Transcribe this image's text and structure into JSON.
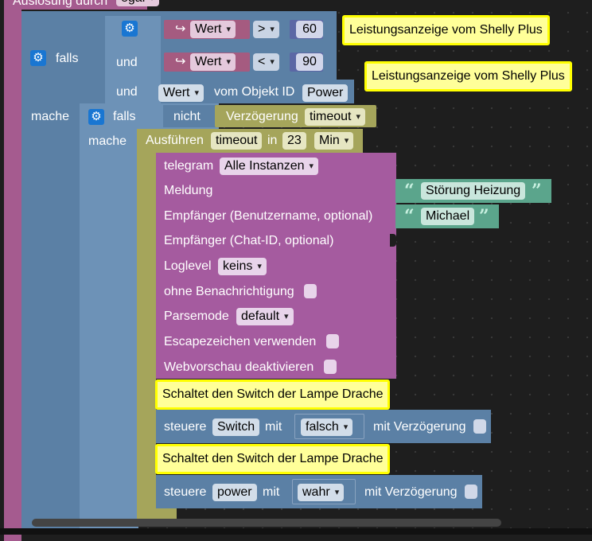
{
  "colors": {
    "purple": "#a55b8f",
    "logic_blue": "#5b80a5",
    "olive": "#a5a55b",
    "telegram_purple": "#a55b9f",
    "text_teal": "#5ba58c",
    "comment_bg": "#ffff99",
    "comment_border": "#ffff00"
  },
  "trigger": {
    "label": "Auslösung durch",
    "value": "egal"
  },
  "if_block": {
    "falls_label": "falls",
    "mache_label": "mache",
    "cond1": {
      "var": "Wert",
      "op": ">",
      "num": "60"
    },
    "und1_label": "und",
    "cond2": {
      "var": "Wert",
      "op": "<",
      "num": "90"
    },
    "und2_label": "und",
    "cond3": {
      "var": "Wert",
      "mid_label": "vom Objekt ID",
      "obj": "Power"
    }
  },
  "comments": {
    "c1": "Leistungsanzeige vom Shelly Plus",
    "c2": "Leistungsanzeige vom Shelly Plus",
    "c3": "Schaltet den Switch der Lampe Drache",
    "c4": "Schaltet den Switch der Lampe Drache"
  },
  "inner_if": {
    "falls_label": "falls",
    "not_label": "nicht",
    "delay_label": "Verzögerung",
    "delay_value": "timeout",
    "mache_label": "mache"
  },
  "execute": {
    "label": "Ausführen",
    "var": "timeout",
    "in_label": "in",
    "num": "23",
    "unit": "Min"
  },
  "telegram": {
    "label": "telegram",
    "instance": "Alle Instanzen",
    "meldung_label": "Meldung",
    "meldung_value": "Störung Heizung",
    "user_label": "Empfänger (Benutzername, optional)",
    "user_value": "Michael",
    "chat_label": "Empfänger (Chat-ID, optional)",
    "loglevel_label": "Loglevel",
    "loglevel_value": "keins",
    "silent_label": "ohne Benachrichtigung",
    "parse_label": "Parsemode",
    "parse_value": "default",
    "escape_label": "Escapezeichen verwenden",
    "preview_label": "Webvorschau deaktivieren"
  },
  "control1": {
    "label": "steuere",
    "target": "Switch",
    "mit_label": "mit",
    "value": "falsch",
    "delay_label": "mit Verzögerung"
  },
  "control2": {
    "label": "steuere",
    "target": "power",
    "mit_label": "mit",
    "value": "wahr",
    "delay_label": "mit Verzögerung"
  }
}
